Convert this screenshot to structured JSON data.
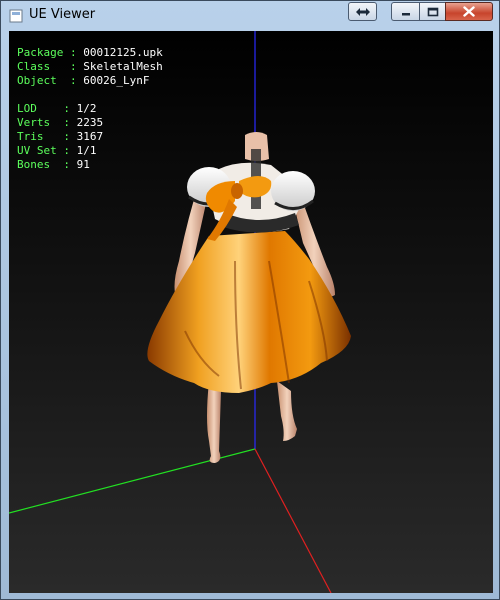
{
  "window": {
    "title": "UE Viewer",
    "icons": [
      "app-icon",
      "sizemove-icon",
      "minimize-icon",
      "maximize-icon",
      "close-icon"
    ]
  },
  "info": {
    "package": {
      "key": "Package",
      "value": "00012125.upk"
    },
    "class": {
      "key": "Class",
      "value": "SkeletalMesh"
    },
    "object": {
      "key": "Object",
      "value": "60026_LynF"
    },
    "lod": {
      "key": "LOD",
      "value": "1/2"
    },
    "verts": {
      "key": "Verts",
      "value": "2235"
    },
    "tris": {
      "key": "Tris",
      "value": "3167"
    },
    "uvset": {
      "key": "UV Set",
      "value": "1/1"
    },
    "bones": {
      "key": "Bones",
      "value": "91"
    }
  },
  "colors": {
    "info_key": "#5cff5c",
    "info_value": "#ffffff",
    "axis_x": "#ff2020",
    "axis_y": "#20ff20",
    "axis_z": "#2020ff",
    "dress": "#f08a00"
  }
}
